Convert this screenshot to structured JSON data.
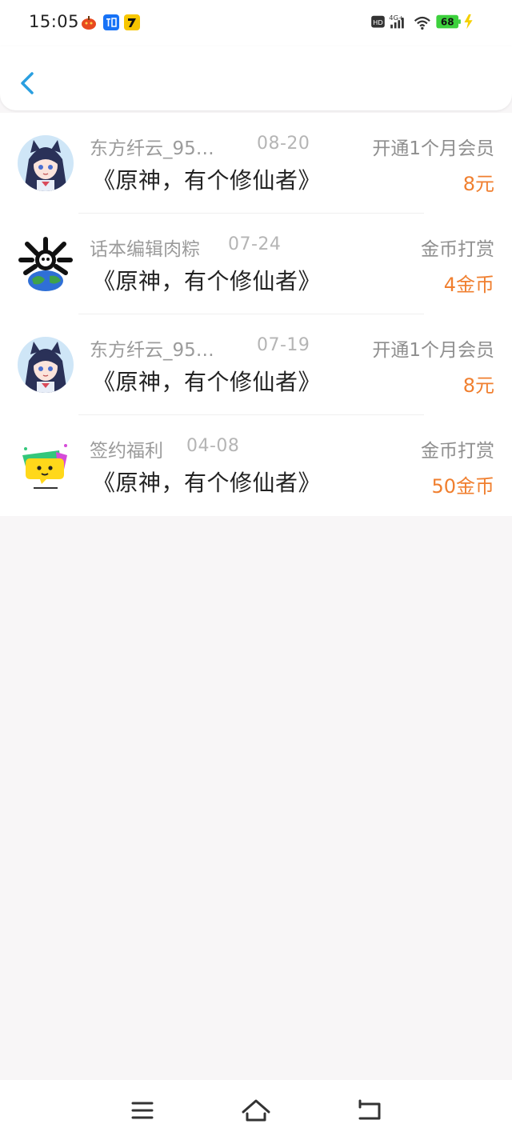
{
  "status_bar": {
    "time": "15:05",
    "battery": "68",
    "network": "4G+",
    "hd": "HD",
    "notification_icons": [
      "pumpkin-icon",
      "zhihu-icon",
      "tiger-icon"
    ]
  },
  "header": {
    "back_icon": "chevron-left-icon"
  },
  "records": [
    {
      "name": "东方纤云_95…",
      "date": "08-20",
      "type": "开通1个月会员",
      "book": "《原神，有个修仙者》",
      "amount": "8元",
      "avatar": "anime-girl-avatar"
    },
    {
      "name": "话本编辑肉粽",
      "date": "07-24",
      "type": "金币打赏",
      "book": "《原神，有个修仙者》",
      "amount": "4金币",
      "avatar": "earth-skull-avatar"
    },
    {
      "name": "东方纤云_95…",
      "date": "07-19",
      "type": "开通1个月会员",
      "book": "《原神，有个修仙者》",
      "amount": "8元",
      "avatar": "anime-girl-avatar"
    },
    {
      "name": "签约福利",
      "date": "04-08",
      "type": "金币打赏",
      "book": "《原神，有个修仙者》",
      "amount": "50金币",
      "avatar": "chat-bubble-avatar"
    }
  ],
  "nav": {
    "icons": [
      "menu-icon",
      "home-icon",
      "back-icon"
    ]
  },
  "colors": {
    "accent_back": "#2a9fe0",
    "amount": "#f07f2f",
    "background": "#f8f6f7"
  }
}
